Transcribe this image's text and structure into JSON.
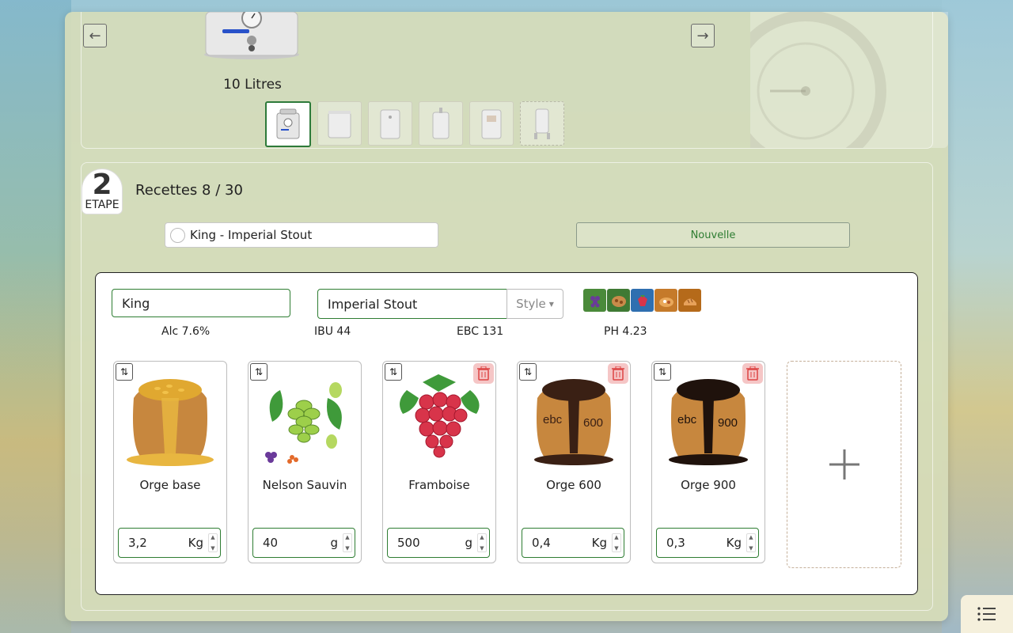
{
  "boiler": {
    "volume_label": "10 Litres",
    "thumbnails": [
      "boiler-10l",
      "boiler-20l",
      "boiler-30l",
      "boiler-40l",
      "boiler-50l",
      "boiler-custom"
    ]
  },
  "step": {
    "number": "2",
    "word": "ETAPE"
  },
  "recipes": {
    "title": "Recettes 8 / 30",
    "selected": "King - Imperial Stout",
    "new_button": "Nouvelle"
  },
  "recipe": {
    "name": "King",
    "style": "Imperial Stout",
    "style_button": "Style",
    "stats": {
      "alc": "Alc 7.6%",
      "ibu": "IBU 44",
      "ebc": "EBC 131",
      "ph": "PH 4.23"
    },
    "flavor_icons": [
      "grape-icon",
      "nuts-icon",
      "berry-icon",
      "caramel-icon",
      "bread-icon"
    ]
  },
  "ingredients": [
    {
      "name": "Orge base",
      "value": "3,2",
      "unit": "Kg",
      "icon": "grain-sack-icon",
      "deletable": false
    },
    {
      "name": "Nelson Sauvin",
      "value": "40",
      "unit": "g",
      "icon": "hop-icon",
      "deletable": false
    },
    {
      "name": "Framboise",
      "value": "500",
      "unit": "g",
      "icon": "raspberry-icon",
      "deletable": true
    },
    {
      "name": "Orge 600",
      "value": "0,4",
      "unit": "Kg",
      "icon": "dark-grain-sack-icon",
      "deletable": true
    },
    {
      "name": "Orge 900",
      "value": "0,3",
      "unit": "Kg",
      "icon": "dark-grain-sack-icon",
      "deletable": true
    }
  ],
  "colors": {
    "accent_green": "#2e7d32",
    "panel_bg": "#d6dcba",
    "trash_bg": "#f5c6c6"
  }
}
